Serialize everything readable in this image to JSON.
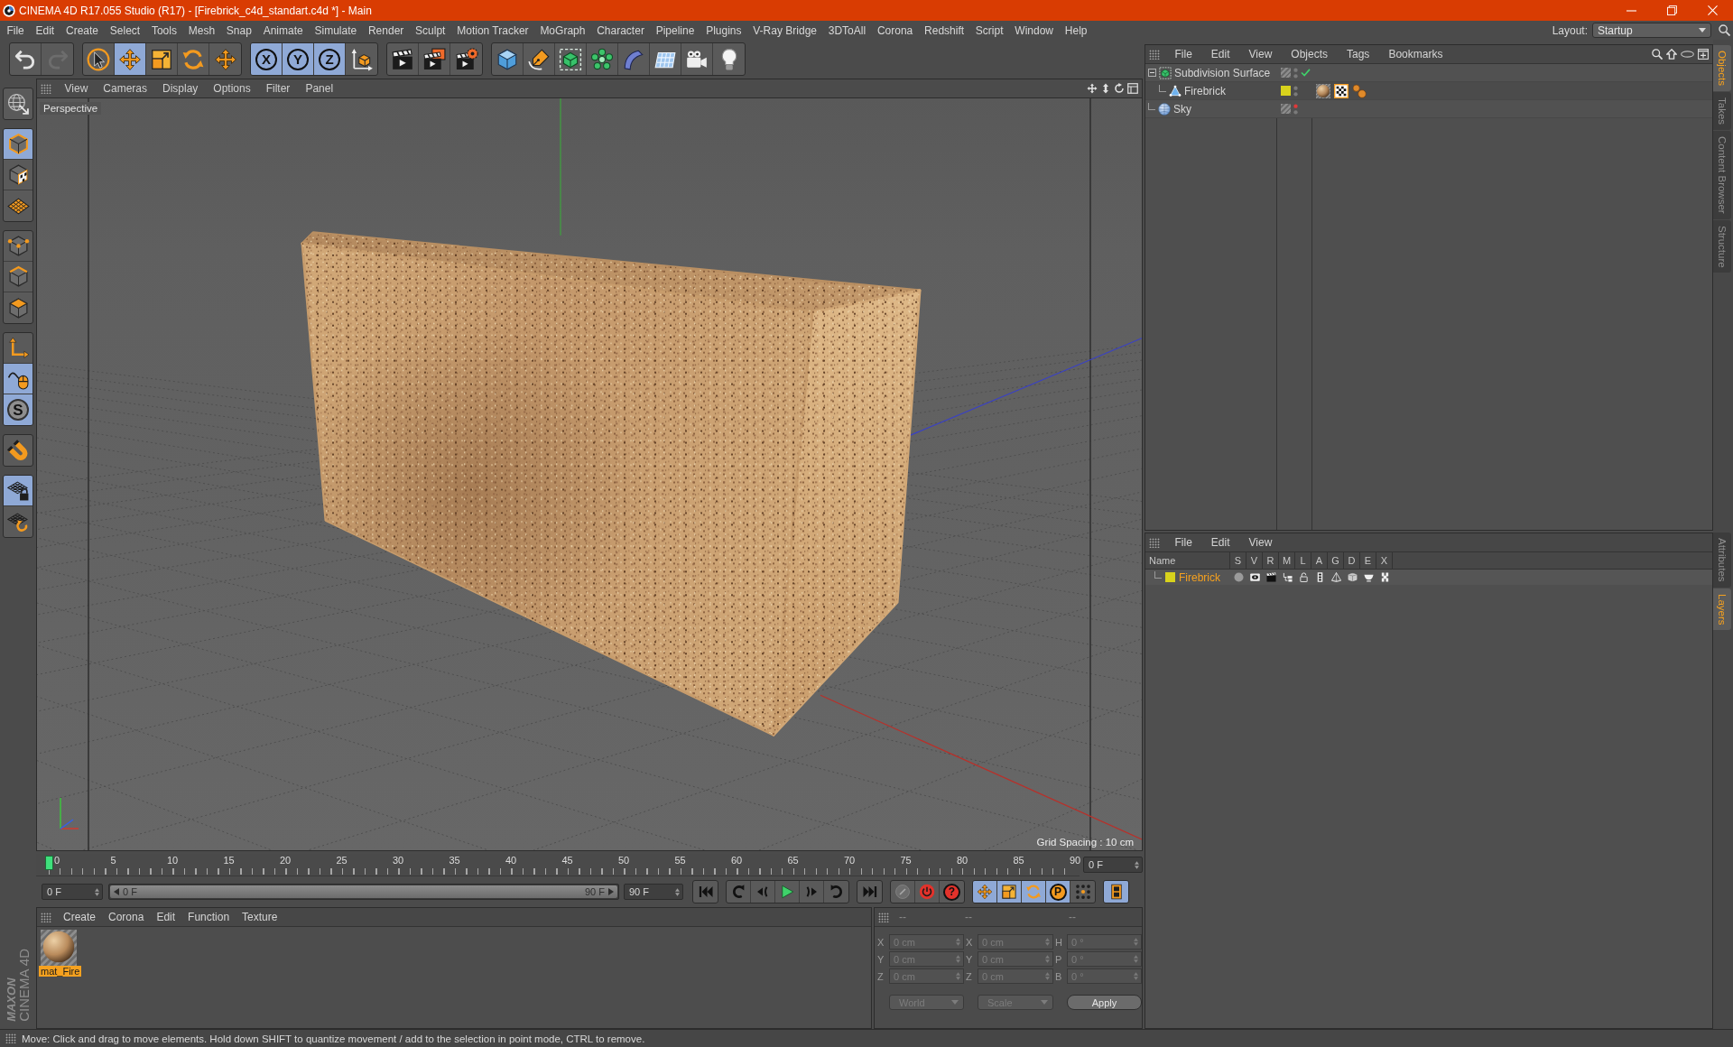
{
  "window": {
    "title": "CINEMA 4D R17.055 Studio (R17) - [Firebrick_c4d_standart.c4d *] - Main"
  },
  "menu_bar": {
    "items": [
      "File",
      "Edit",
      "Create",
      "Select",
      "Tools",
      "Mesh",
      "Snap",
      "Animate",
      "Simulate",
      "Render",
      "Sculpt",
      "Motion Tracker",
      "MoGraph",
      "Character",
      "Pipeline",
      "Plugins",
      "V-Ray Bridge",
      "3DToAll",
      "Corona",
      "Redshift",
      "Script",
      "Window",
      "Help"
    ],
    "layout_label": "Layout:",
    "layout_value": "Startup"
  },
  "toolbar": [
    [
      {
        "kind": "undo",
        "active": false,
        "disabled": false
      },
      {
        "kind": "redo",
        "active": false,
        "disabled": true
      }
    ],
    [
      {
        "kind": "select",
        "active": false,
        "disabled": false
      },
      {
        "kind": "move",
        "active": true,
        "disabled": false
      },
      {
        "kind": "scale",
        "active": false,
        "disabled": false
      },
      {
        "kind": "rotate",
        "active": false,
        "disabled": false
      },
      {
        "kind": "recent",
        "active": false,
        "disabled": false
      }
    ],
    [
      {
        "kind": "constraint",
        "label": "X",
        "active": true,
        "disabled": false
      },
      {
        "kind": "constraint",
        "label": "Y",
        "active": true,
        "disabled": false
      },
      {
        "kind": "constraint",
        "label": "Z",
        "active": true,
        "disabled": false
      },
      {
        "kind": "coordinates",
        "active": false,
        "disabled": false
      }
    ],
    [
      {
        "kind": "render",
        "active": false,
        "disabled": false
      },
      {
        "kind": "picture",
        "active": false,
        "disabled": false
      },
      {
        "kind": "settings",
        "active": false,
        "disabled": false
      }
    ],
    [
      {
        "kind": "cube",
        "active": false,
        "disabled": false
      },
      {
        "kind": "pen",
        "active": false,
        "disabled": false
      },
      {
        "kind": "subdivision",
        "active": false,
        "disabled": false
      },
      {
        "kind": "cloner",
        "active": false,
        "disabled": false
      },
      {
        "kind": "bend",
        "active": false,
        "disabled": false
      },
      {
        "kind": "floor",
        "active": false,
        "disabled": false
      },
      {
        "kind": "camera",
        "active": false,
        "disabled": false
      },
      {
        "kind": "light",
        "active": false,
        "disabled": false
      }
    ]
  ],
  "tool_palette": [
    [
      {
        "kind": "editable",
        "active": false
      }
    ],
    [
      {
        "kind": "model",
        "active": true
      },
      {
        "kind": "texture",
        "active": false
      },
      {
        "kind": "workplane",
        "active": false
      }
    ],
    [
      {
        "kind": "points",
        "active": false
      },
      {
        "kind": "edges",
        "active": false
      },
      {
        "kind": "polygons",
        "active": false
      }
    ],
    [
      {
        "kind": "axis",
        "active": false
      },
      {
        "kind": "tweak",
        "active": true
      },
      {
        "kind": "solo",
        "label": "S",
        "active": true
      }
    ],
    [
      {
        "kind": "snap",
        "active": false
      }
    ],
    [
      {
        "kind": "planelock",
        "active": true
      },
      {
        "kind": "planar",
        "active": false
      }
    ]
  ],
  "brand": {
    "company": "MAXON",
    "product": "CINEMA 4D"
  },
  "viewport": {
    "menu": [
      "View",
      "Cameras",
      "Display",
      "Options",
      "Filter",
      "Panel"
    ],
    "camera": "Perspective",
    "grid_spacing": "Grid Spacing : 10 cm"
  },
  "timeline": {
    "ticks": [
      "0",
      "5",
      "10",
      "15",
      "20",
      "25",
      "30",
      "35",
      "40",
      "45",
      "50",
      "55",
      "60",
      "65",
      "70",
      "75",
      "80",
      "85",
      "90"
    ],
    "level": 0,
    "current_frame": "0 F"
  },
  "transport": {
    "start_frame": "0 F",
    "range": {
      "start": "0 F",
      "end": "90 F",
      "level": 1
    },
    "end_frame": "90 F",
    "buttons": [
      [
        {
          "kind": "first",
          "active": false
        }
      ],
      [
        {
          "kind": "prevkey",
          "active": false
        },
        {
          "kind": "prevframe",
          "active": false
        },
        {
          "kind": "play",
          "active": false
        },
        {
          "kind": "nextframe",
          "active": false
        },
        {
          "kind": "nextkey",
          "active": false
        }
      ],
      [
        {
          "kind": "last",
          "active": false
        }
      ],
      [
        {
          "kind": "autokey",
          "active": false
        },
        {
          "kind": "record",
          "active": false
        },
        {
          "kind": "keysel",
          "label": "?",
          "active": false
        }
      ],
      [
        {
          "kind": "position",
          "active": true
        },
        {
          "kind": "scaling",
          "active": true
        },
        {
          "kind": "rotation",
          "active": true
        },
        {
          "kind": "parameter",
          "label": "P",
          "active": true
        },
        {
          "kind": "pla",
          "active": false
        }
      ],
      [
        {
          "kind": "timeline",
          "active": true
        }
      ]
    ]
  },
  "materials": {
    "menu": [
      "Create",
      "Corona",
      "Edit",
      "Function",
      "Texture"
    ],
    "items": [
      {
        "name": "mat_Fire",
        "selected": true
      }
    ]
  },
  "coordinates": {
    "disabled": true,
    "headers": [
      "--",
      "--",
      "--"
    ],
    "rows": [
      [
        {
          "axis": "X",
          "value": "0 cm"
        },
        {
          "axis": "X",
          "value": "0 cm"
        },
        {
          "axis": "H",
          "value": "0 °"
        }
      ],
      [
        {
          "axis": "Y",
          "value": "0 cm"
        },
        {
          "axis": "Y",
          "value": "0 cm"
        },
        {
          "axis": "P",
          "value": "0 °"
        }
      ],
      [
        {
          "axis": "Z",
          "value": "0 cm"
        },
        {
          "axis": "Z",
          "value": "0 cm"
        },
        {
          "axis": "B",
          "value": "0 °"
        }
      ]
    ],
    "mode": "World",
    "transform": "Scale",
    "apply": "Apply"
  },
  "objects": {
    "menu": [
      "File",
      "Edit",
      "View",
      "Objects",
      "Tags",
      "Bookmarks"
    ],
    "tree": [
      {
        "name": "Subdivision Surface",
        "kind": "subdivision",
        "selected": false,
        "expanded": true,
        "enabled": true,
        "editor_hidden": false,
        "children": [
          {
            "name": "Firebrick",
            "kind": "polygon",
            "selected": false,
            "color": "#d8d21c",
            "editor_hidden": false,
            "tags": [
              {
                "kind": "material"
              },
              {
                "kind": "uvw"
              },
              {
                "kind": "dots"
              }
            ]
          }
        ]
      },
      {
        "name": "Sky",
        "kind": "sky",
        "selected": false,
        "editor_hidden": true
      }
    ]
  },
  "layers": {
    "menu": [
      "File",
      "Edit",
      "View"
    ],
    "columns": [
      "Name",
      "S",
      "V",
      "R",
      "M",
      "L",
      "A",
      "G",
      "D",
      "E",
      "X"
    ],
    "rows": [
      {
        "name": "Firebrick",
        "color": "#d8d21c",
        "selected": true
      }
    ]
  },
  "side_tabs": {
    "upper": [
      {
        "label": "Objects",
        "selected": true
      },
      {
        "label": "Takes",
        "selected": false
      },
      {
        "label": "Content Browser",
        "selected": false
      },
      {
        "label": "Structure",
        "selected": false
      }
    ],
    "lower": [
      {
        "label": "Attributes",
        "selected": false
      },
      {
        "label": "Layers",
        "selected": true
      }
    ]
  },
  "status_bar": {
    "text": "Move: Click and drag to move elements. Hold down SHIFT to quantize movement / add to the selection in point mode, CTRL to remove."
  }
}
